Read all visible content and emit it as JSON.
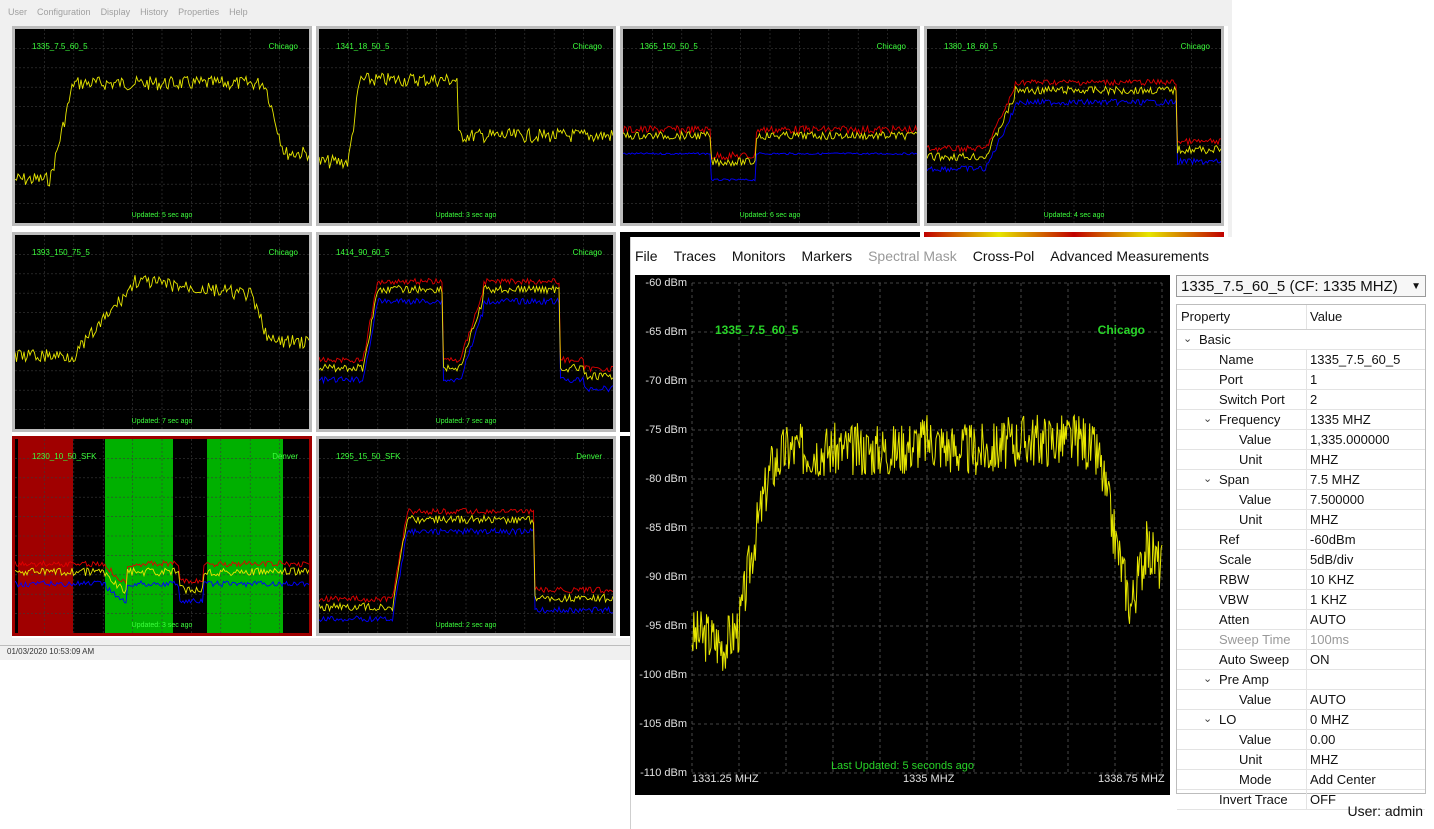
{
  "bg_window": {
    "menu": [
      "User",
      "Configuration",
      "Display",
      "History",
      "Properties",
      "Help"
    ],
    "timestamp": "01/03/2020 10:53:09 AM",
    "tiles": [
      {
        "name": "1335_7.5_60_5",
        "location": "Chicago",
        "updated": "Updated: 5 sec ago"
      },
      {
        "name": "1341_18_50_5",
        "location": "Chicago",
        "updated": "Updated: 3 sec ago"
      },
      {
        "name": "1365_150_50_5",
        "location": "Chicago",
        "updated": "Updated: 6 sec ago"
      },
      {
        "name": "1380_18_60_5",
        "location": "Chicago",
        "updated": "Updated: 4 sec ago"
      },
      {
        "name": "1393_150_75_5",
        "location": "Chicago",
        "updated": "Updated: 7 sec ago"
      },
      {
        "name": "1414_90_60_5",
        "location": "Chicago",
        "updated": "Updated: 7 sec ago"
      },
      {
        "name": "1230_10_50_SFK",
        "location": "Denver",
        "updated": "Updated: 3 sec ago"
      },
      {
        "name": "1295_15_50_SFK",
        "location": "Denver",
        "updated": "Updated: 2 sec ago"
      }
    ]
  },
  "front_window": {
    "menu": [
      {
        "label": "File",
        "enabled": true
      },
      {
        "label": "Traces",
        "enabled": true
      },
      {
        "label": "Monitors",
        "enabled": true
      },
      {
        "label": "Markers",
        "enabled": true
      },
      {
        "label": "Spectral Mask",
        "enabled": false
      },
      {
        "label": "Cross-Pol",
        "enabled": true
      },
      {
        "label": "Advanced Measurements",
        "enabled": true
      }
    ],
    "device_select": "1335_7.5_60_5 (CF: 1335 MHZ)",
    "plot": {
      "trace_name": "1335_7.5_60_5",
      "location": "Chicago",
      "last_updated": "Last Updated: 5 seconds ago",
      "trace_color": "#e6e600",
      "label_color": "#28d428"
    },
    "properties": {
      "col_property": "Property",
      "col_value": "Value",
      "rows": [
        {
          "name": "Basic",
          "value": "",
          "level": 0,
          "expander": true
        },
        {
          "name": "Name",
          "value": "1335_7.5_60_5",
          "level": 1,
          "expander": false
        },
        {
          "name": "Port",
          "value": "1",
          "level": 1,
          "expander": false
        },
        {
          "name": "Switch Port",
          "value": "2",
          "level": 1,
          "expander": false
        },
        {
          "name": "Frequency",
          "value": "1335 MHZ",
          "level": 1,
          "expander": true
        },
        {
          "name": "Value",
          "value": "1,335.000000",
          "level": 2,
          "expander": false
        },
        {
          "name": "Unit",
          "value": "MHZ",
          "level": 2,
          "expander": false
        },
        {
          "name": "Span",
          "value": "7.5 MHZ",
          "level": 1,
          "expander": true
        },
        {
          "name": "Value",
          "value": "7.500000",
          "level": 2,
          "expander": false
        },
        {
          "name": "Unit",
          "value": "MHZ",
          "level": 2,
          "expander": false
        },
        {
          "name": "Ref",
          "value": "-60dBm",
          "level": 1,
          "expander": false
        },
        {
          "name": "Scale",
          "value": "5dB/div",
          "level": 1,
          "expander": false
        },
        {
          "name": "RBW",
          "value": "10 KHZ",
          "level": 1,
          "expander": false
        },
        {
          "name": "VBW",
          "value": "1 KHZ",
          "level": 1,
          "expander": false
        },
        {
          "name": "Atten",
          "value": "AUTO",
          "level": 1,
          "expander": false
        },
        {
          "name": "Sweep Time",
          "value": "100ms",
          "level": 1,
          "expander": false,
          "disabled": true
        },
        {
          "name": "Auto Sweep",
          "value": "ON",
          "level": 1,
          "expander": false
        },
        {
          "name": "Pre Amp",
          "value": "",
          "level": 1,
          "expander": true
        },
        {
          "name": "Value",
          "value": "AUTO",
          "level": 2,
          "expander": false
        },
        {
          "name": "LO",
          "value": "0 MHZ",
          "level": 1,
          "expander": true
        },
        {
          "name": "Value",
          "value": "0.00",
          "level": 2,
          "expander": false
        },
        {
          "name": "Unit",
          "value": "MHZ",
          "level": 2,
          "expander": false
        },
        {
          "name": "Mode",
          "value": "Add Center",
          "level": 2,
          "expander": false
        },
        {
          "name": "Invert Trace",
          "value": "OFF",
          "level": 1,
          "expander": false
        }
      ]
    },
    "status_user": "User: admin"
  },
  "chart_data": {
    "type": "line",
    "title": "1335_7.5_60_5",
    "xlabel": "",
    "ylabel": "",
    "x_ticks": [
      "1331.25 MHZ",
      "1335 MHZ",
      "1338.75 MHZ"
    ],
    "y_ticks": [
      "-60 dBm",
      "-65 dBm",
      "-70 dBm",
      "-75 dBm",
      "-80 dBm",
      "-85 dBm",
      "-90 dBm",
      "-95 dBm",
      "-100 dBm",
      "-105 dBm",
      "-110 dBm"
    ],
    "xlim": [
      1331.25,
      1338.75
    ],
    "ylim": [
      -110,
      -60
    ],
    "grid": true,
    "series": [
      {
        "x": [
          1331.25,
          1331.5,
          1331.75,
          1332.0,
          1332.25,
          1332.5,
          1332.75,
          1333.0,
          1333.5,
          1334.0,
          1334.5,
          1335.0,
          1335.5,
          1336.0,
          1336.5,
          1337.0,
          1337.5,
          1337.75,
          1338.0,
          1338.25,
          1338.5,
          1338.75
        ],
        "values": [
          -96,
          -96,
          -97,
          -95,
          -86,
          -79,
          -77,
          -77,
          -77,
          -77,
          -77,
          -76,
          -77,
          -77,
          -76,
          -76,
          -76,
          -78,
          -86,
          -93,
          -87,
          -89
        ]
      }
    ]
  }
}
